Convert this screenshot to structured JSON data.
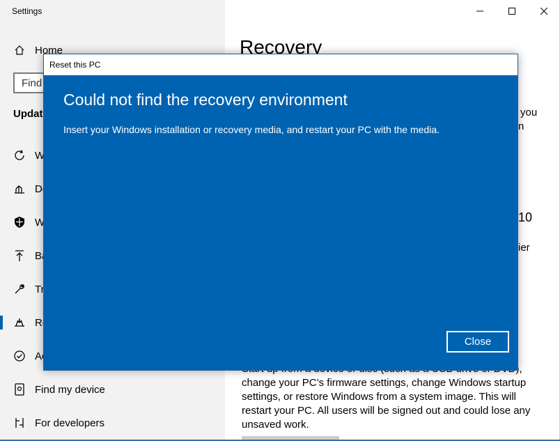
{
  "window": {
    "title": "Settings"
  },
  "sidebar": {
    "home_label": "Home",
    "search_placeholder": "Find a setting",
    "search_value": "Find",
    "section_head": "Update & Security",
    "items": [
      {
        "label": "Windows Update",
        "visible_text": "W",
        "icon": "refresh-icon"
      },
      {
        "label": "Delivery Optimization",
        "visible_text": "De",
        "icon": "delivery-icon"
      },
      {
        "label": "Windows Security",
        "visible_text": "W",
        "icon": "shield-icon"
      },
      {
        "label": "Backup",
        "visible_text": "Ba",
        "icon": "backup-arrow-icon"
      },
      {
        "label": "Troubleshoot",
        "visible_text": "Tr",
        "icon": "wrench-icon"
      },
      {
        "label": "Recovery",
        "visible_text": "Re",
        "icon": "recovery-icon"
      },
      {
        "label": "Activation",
        "visible_text": "Ac",
        "icon": "check-circle-icon"
      },
      {
        "label": "Find my device",
        "visible_text": "Find my device",
        "icon": "find-device-icon"
      },
      {
        "label": "For developers",
        "visible_text": "For developers",
        "icon": "developer-icon"
      }
    ]
  },
  "content": {
    "page_title": "Recovery",
    "frag_you": "you",
    "frag_n": "n",
    "frag_10": "10",
    "frag_ier": "ier",
    "advanced_startup_text_clipped": "Start up from a device or disc (such as a USB drive or DVD),",
    "advanced_startup_text_lines": [
      "change your PC’s firmware settings, change Windows startup",
      "settings, or restore Windows from a system image. This will",
      "restart your PC. All users will be signed out and could lose any",
      "unsaved work."
    ]
  },
  "dialog": {
    "title": "Reset this PC",
    "heading": "Could not find the recovery environment",
    "message": "Insert your Windows installation or recovery media, and restart your PC with the media.",
    "close_label": "Close"
  },
  "colors": {
    "dialog_background": "#0063b1",
    "accent": "#0063b1",
    "sidebar_background": "#f2f2f2"
  }
}
